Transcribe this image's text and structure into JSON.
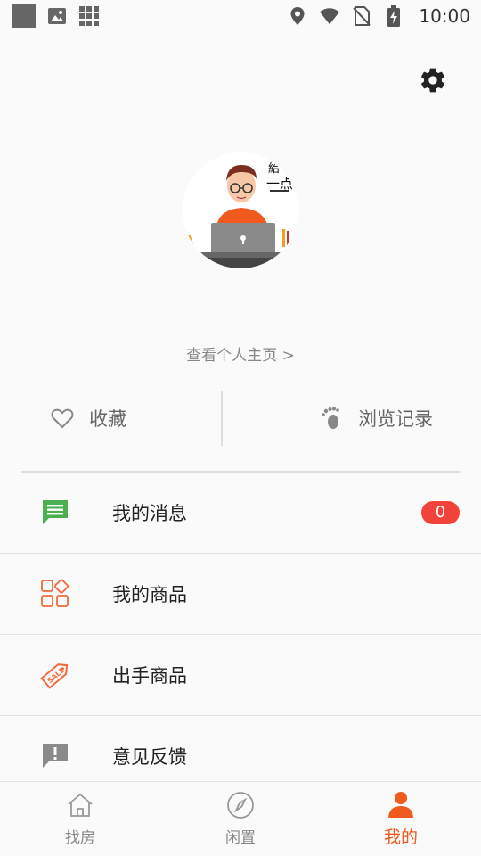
{
  "status_bar": {
    "time": "10:00"
  },
  "profile": {
    "view_homepage_link": "查看个人主页 >"
  },
  "stats": {
    "favorites_label": "收藏",
    "history_label": "浏览记录"
  },
  "menu": {
    "items": [
      {
        "label": "我的消息",
        "icon": "message-icon",
        "badge": "0",
        "color": "#4caf50"
      },
      {
        "label": "我的商品",
        "icon": "grid-icon",
        "color": "#f26b3a"
      },
      {
        "label": "出手商品",
        "icon": "sale-tag-icon",
        "color": "#f26b3a"
      },
      {
        "label": "意见反馈",
        "icon": "feedback-icon",
        "color": "#8a8a8a"
      }
    ]
  },
  "bottom_nav": {
    "tabs": [
      {
        "label": "找房",
        "icon": "house-icon"
      },
      {
        "label": "闲置",
        "icon": "compass-icon"
      },
      {
        "label": "我的",
        "icon": "person-icon",
        "active": true
      }
    ]
  },
  "colors": {
    "accent": "#f05a1e",
    "badge": "#f2433a",
    "message_green": "#4caf50"
  }
}
